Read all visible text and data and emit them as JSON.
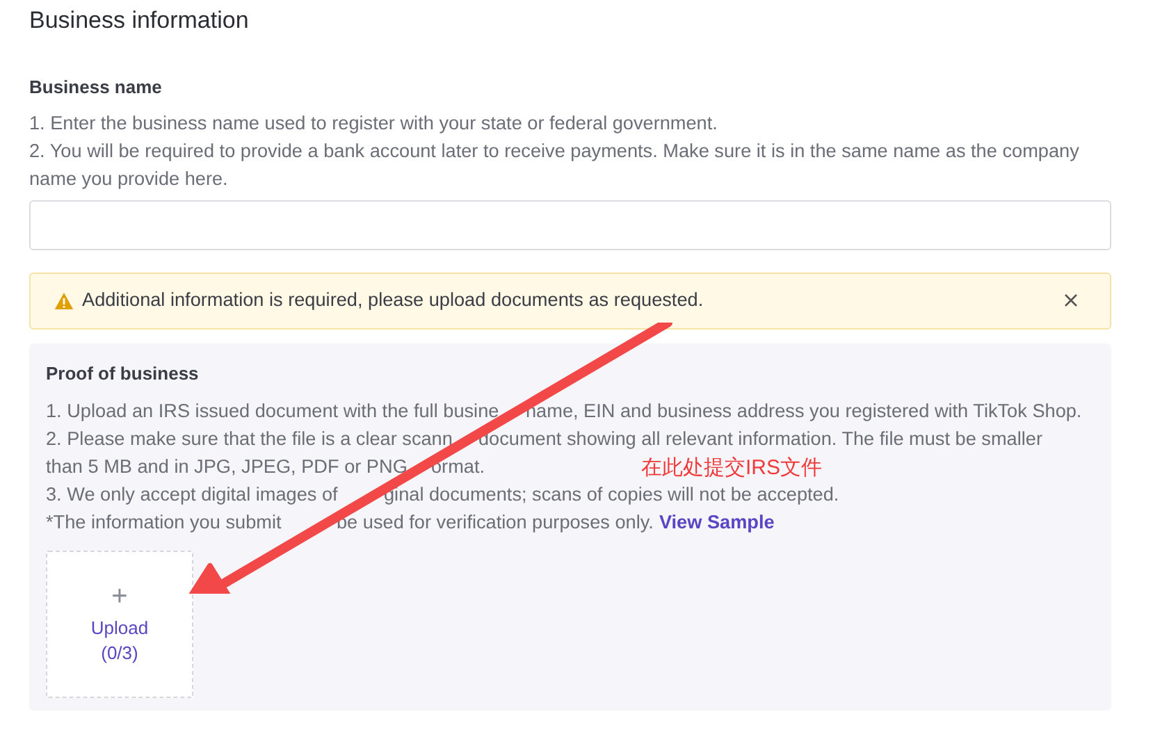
{
  "title": "Business information",
  "business_name": {
    "label": "Business name",
    "hints": [
      "1. Enter the business name used to register with your state or federal government.",
      "2. You will be required to provide a bank account later to receive payments. Make sure it is in the same name as the company name you provide here."
    ]
  },
  "alert": {
    "kind": "warning",
    "message": "Additional information is required, please upload documents as requested."
  },
  "proof": {
    "title": "Proof of business",
    "rows": [
      [
        "1. Upload an IRS issued document with the full busine",
        "name, EIN and business address you registered with TikTok Shop."
      ],
      [
        "2. Please make sure that the file is a clear scann",
        "document showing all relevant information. The file must be smaller"
      ],
      [
        "than 5 MB and in JPG, JPEG, PDF or PNG",
        "ormat."
      ],
      [
        "3. We only accept digital images of",
        "ginal documents; scans of copies will not be accepted."
      ],
      [
        "*The information you submit",
        "be used for verification purposes only."
      ]
    ],
    "link": "View Sample",
    "upload": {
      "icon": "+",
      "label": "Upload",
      "count": "(0/3)"
    }
  },
  "annotation": {
    "text": "在此处提交IRS文件"
  }
}
